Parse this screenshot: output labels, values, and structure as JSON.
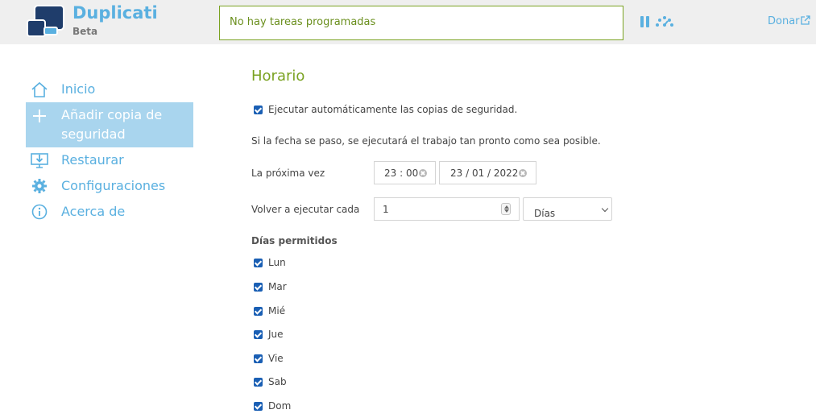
{
  "header": {
    "brand": "Duplicati",
    "brand_sub": "Beta",
    "status": "No hay tareas programadas",
    "donate": "Donar",
    "accent": "#5ab0e0",
    "status_color": "#7aa221"
  },
  "sidebar": {
    "items": [
      {
        "label": "Inicio",
        "icon": "home-icon"
      },
      {
        "label": "Añadir copia de",
        "label2": "seguridad",
        "icon": "plus-icon",
        "active": true
      },
      {
        "label": "Restaurar",
        "icon": "restore-icon"
      },
      {
        "label": "Configuraciones",
        "icon": "gear-icon"
      },
      {
        "label": "Acerca de",
        "icon": "info-icon"
      }
    ]
  },
  "main": {
    "title": "Horario",
    "auto_run_label": "Ejecutar automáticamente las copias de seguridad.",
    "auto_run_checked": true,
    "past_date_note": "Si la fecha se paso, se ejecutará el trabajo tan pronto como sea posible.",
    "next_time_label": "La próxima vez",
    "next_time_value": "23 : 00",
    "next_date_value": "23 / 01 / 2022",
    "repeat_label": "Volver a ejecutar cada",
    "repeat_value": "1",
    "repeat_unit": "Días",
    "allowed_days_label": "Días permitidos",
    "days": [
      {
        "label": "Lun",
        "checked": true
      },
      {
        "label": "Mar",
        "checked": true
      },
      {
        "label": "Mié",
        "checked": true
      },
      {
        "label": "Jue",
        "checked": true
      },
      {
        "label": "Vie",
        "checked": true
      },
      {
        "label": "Sab",
        "checked": true
      },
      {
        "label": "Dom",
        "checked": true
      }
    ]
  }
}
